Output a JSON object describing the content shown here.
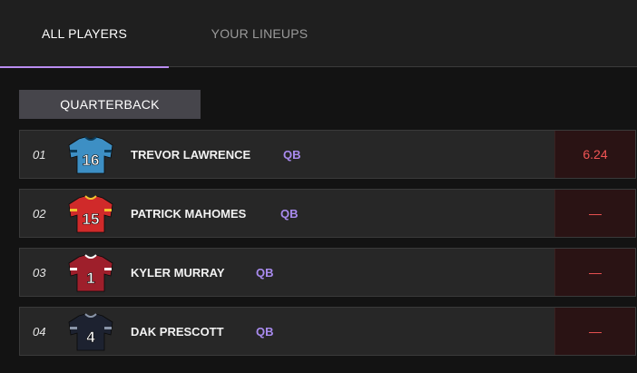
{
  "tabs": {
    "all_players": "ALL PLAYERS",
    "your_lineups": "YOUR LINEUPS"
  },
  "section": {
    "title": "QUARTERBACK"
  },
  "players": [
    {
      "rank": "01",
      "name": "TREVOR LAWRENCE",
      "position": "QB",
      "score": "6.24",
      "jersey_number": "16",
      "jersey_color": "#3d8fc4",
      "number_color": "#ffffff",
      "trim_color": "#0c3c5a"
    },
    {
      "rank": "02",
      "name": "PATRICK MAHOMES",
      "position": "QB",
      "score": "—",
      "jersey_number": "15",
      "jersey_color": "#d02a2a",
      "number_color": "#ffffff",
      "trim_color": "#f2c230"
    },
    {
      "rank": "03",
      "name": "KYLER MURRAY",
      "position": "QB",
      "score": "—",
      "jersey_number": "1",
      "jersey_color": "#9e1f2b",
      "number_color": "#ffffff",
      "trim_color": "#ffffff"
    },
    {
      "rank": "04",
      "name": "DAK PRESCOTT",
      "position": "QB",
      "score": "—",
      "jersey_number": "4",
      "jersey_color": "#1d2230",
      "number_color": "#ffffff",
      "trim_color": "#8a95a8"
    }
  ],
  "colors": {
    "accent": "#b98cf0",
    "position_text": "#a98bef",
    "score_text": "#f25555",
    "score_bg": "#2a1314"
  }
}
